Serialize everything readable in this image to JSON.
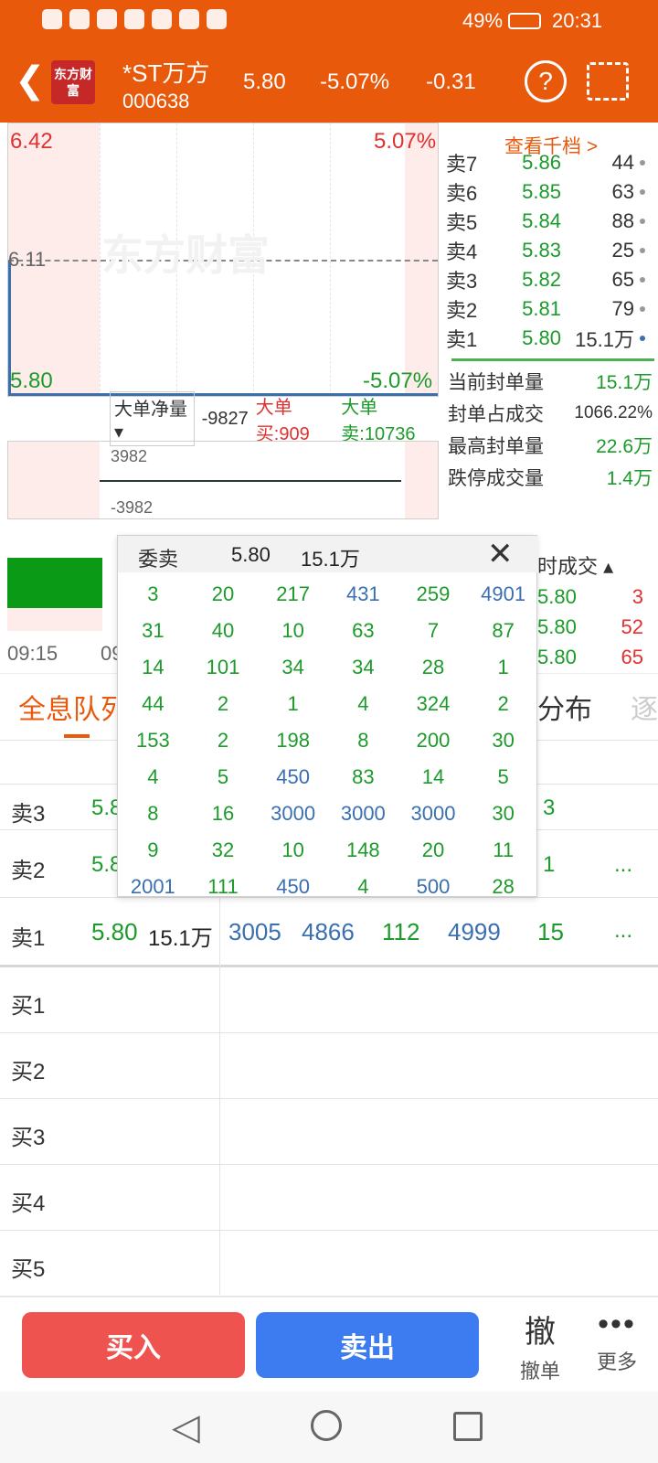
{
  "status_bar": {
    "battery": "49%",
    "time": "20:31"
  },
  "header": {
    "logo_text": "东方财富",
    "stock_name": "*ST万方",
    "stock_code": "000638",
    "price": "5.80",
    "change_pct": "-5.07%",
    "change": "-0.31"
  },
  "chart": {
    "top_price": "6.42",
    "top_pct": "5.07%",
    "mid_price": "6.11",
    "bottom_price": "5.80",
    "bottom_pct": "-5.07%",
    "watermark": "东方财富",
    "big_order_net_label": "大单净量",
    "big_order_net_value": "-9827",
    "big_buy": "大单买:909",
    "big_sell": "大单卖:10736",
    "sub_top": "3982",
    "sub_bottom": "-3982",
    "time_start": "09:15",
    "time_partial": "09"
  },
  "order_book": {
    "view_more": "查看千档 >",
    "asks": [
      {
        "label": "卖7",
        "price": "5.86",
        "vol": "44"
      },
      {
        "label": "卖6",
        "price": "5.85",
        "vol": "63"
      },
      {
        "label": "卖5",
        "price": "5.84",
        "vol": "88"
      },
      {
        "label": "卖4",
        "price": "5.83",
        "vol": "25"
      },
      {
        "label": "卖3",
        "price": "5.82",
        "vol": "65"
      },
      {
        "label": "卖2",
        "price": "5.81",
        "vol": "79"
      },
      {
        "label": "卖1",
        "price": "5.80",
        "vol": "15.1万"
      }
    ]
  },
  "stats": [
    {
      "label": "当前封单量",
      "value": "15.1万"
    },
    {
      "label": "封单占成交",
      "value": "1066.22%"
    },
    {
      "label": "最高封单量",
      "value": "22.6万"
    },
    {
      "label": "跌停成交量",
      "value": "1.4万"
    }
  ],
  "trades": {
    "header": "时成交",
    "rows": [
      {
        "price": "5.80",
        "vol": "3"
      },
      {
        "price": "5.80",
        "vol": "52"
      },
      {
        "price": "5.80",
        "vol": "65"
      }
    ]
  },
  "tabs": {
    "queue": "全息队列",
    "dist": "分布",
    "next": "逐"
  },
  "queue": {
    "sell3": {
      "label": "卖3",
      "price": "5.8",
      "tail": "3"
    },
    "sell2": {
      "label": "卖2",
      "price": "5.8",
      "tail": "1",
      "more": "..."
    },
    "sell1": {
      "label": "卖1",
      "price": "5.80",
      "vol": "15.1万",
      "orders": [
        "3005",
        "4866",
        "112",
        "4999",
        "15"
      ],
      "more": "..."
    },
    "buys": [
      "买1",
      "买2",
      "买3",
      "买4",
      "买5"
    ]
  },
  "popup": {
    "title": "委卖",
    "price": "5.80",
    "vol": "15.1万",
    "cells": [
      [
        "3",
        "g"
      ],
      [
        "20",
        "g"
      ],
      [
        "217",
        "g"
      ],
      [
        "431",
        "b"
      ],
      [
        "259",
        "g"
      ],
      [
        "4901",
        "b"
      ],
      [
        "31",
        "g"
      ],
      [
        "40",
        "g"
      ],
      [
        "10",
        "g"
      ],
      [
        "63",
        "g"
      ],
      [
        "7",
        "g"
      ],
      [
        "87",
        "g"
      ],
      [
        "14",
        "g"
      ],
      [
        "101",
        "g"
      ],
      [
        "34",
        "g"
      ],
      [
        "34",
        "g"
      ],
      [
        "28",
        "g"
      ],
      [
        "1",
        "g"
      ],
      [
        "44",
        "g"
      ],
      [
        "2",
        "g"
      ],
      [
        "1",
        "g"
      ],
      [
        "4",
        "g"
      ],
      [
        "324",
        "g"
      ],
      [
        "2",
        "g"
      ],
      [
        "153",
        "g"
      ],
      [
        "2",
        "g"
      ],
      [
        "198",
        "g"
      ],
      [
        "8",
        "g"
      ],
      [
        "200",
        "g"
      ],
      [
        "30",
        "g"
      ],
      [
        "4",
        "g"
      ],
      [
        "5",
        "g"
      ],
      [
        "450",
        "b"
      ],
      [
        "83",
        "g"
      ],
      [
        "14",
        "g"
      ],
      [
        "5",
        "g"
      ],
      [
        "8",
        "g"
      ],
      [
        "16",
        "g"
      ],
      [
        "3000",
        "b"
      ],
      [
        "3000",
        "b"
      ],
      [
        "3000",
        "b"
      ],
      [
        "30",
        "g"
      ],
      [
        "9",
        "g"
      ],
      [
        "32",
        "g"
      ],
      [
        "10",
        "g"
      ],
      [
        "148",
        "g"
      ],
      [
        "20",
        "g"
      ],
      [
        "11",
        "g"
      ],
      [
        "2001",
        "b"
      ],
      [
        "111",
        "g"
      ],
      [
        "450",
        "b"
      ],
      [
        "4",
        "g"
      ],
      [
        "500",
        "b"
      ],
      [
        "28",
        "g"
      ]
    ]
  },
  "bottom": {
    "buy": "买入",
    "sell": "卖出",
    "cancel_icon_text": "撤",
    "cancel": "撤单",
    "more": "更多"
  },
  "colors": {
    "brand": "#e8590c",
    "buy": "#ef5350",
    "sell": "#3d7cf0"
  }
}
